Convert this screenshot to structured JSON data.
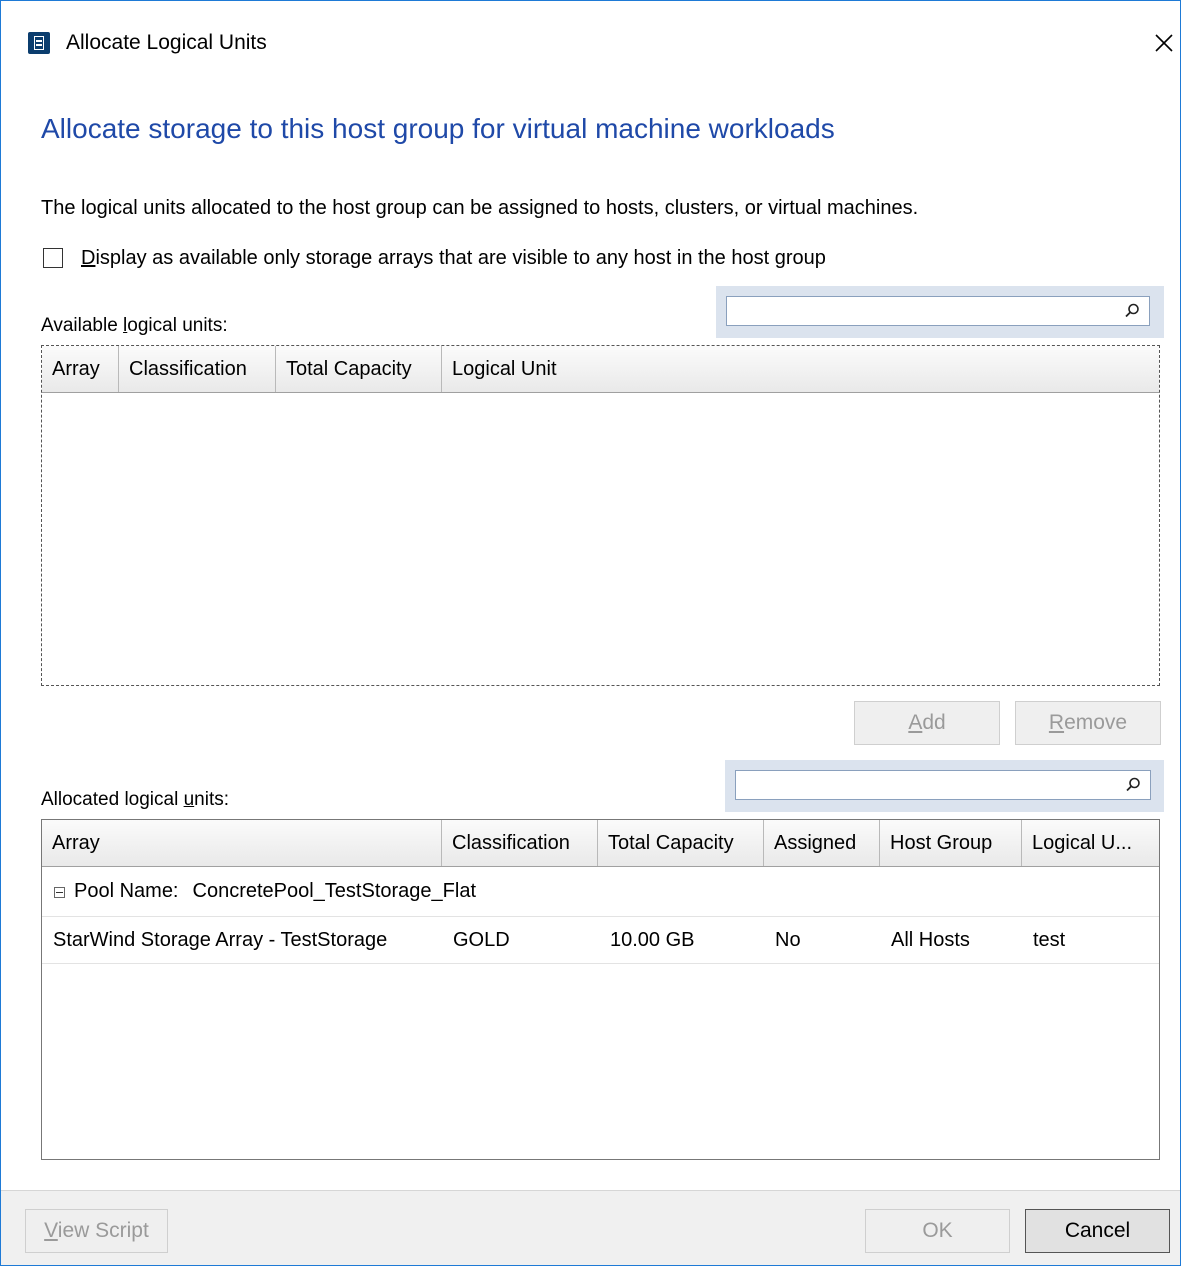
{
  "window": {
    "title": "Allocate Logical Units",
    "icon": "app-icon",
    "close_icon": "close-icon"
  },
  "heading": "Allocate storage to this host group for virtual machine workloads",
  "description": "The logical units allocated to the host group can be assigned to hosts, clusters, or virtual machines.",
  "filter_checkbox": {
    "label_mnemonic": "D",
    "label_rest": "isplay as available only storage arrays that are visible to any host in the host group",
    "checked": false
  },
  "available": {
    "label_prefix": "Available ",
    "label_mnemonic": "l",
    "label_suffix": "ogical units:",
    "search": {
      "value": "",
      "placeholder": "",
      "icon": "search-icon"
    },
    "columns": [
      "Array",
      "Classification",
      "Total Capacity",
      "Logical Unit"
    ],
    "rows": []
  },
  "buttons": {
    "add_mnemonic": "A",
    "add_rest": "dd",
    "remove_mnemonic": "R",
    "remove_rest": "emove"
  },
  "allocated": {
    "label_prefix": "Allocated logical ",
    "label_mnemonic": "u",
    "label_suffix": "nits:",
    "search": {
      "value": "",
      "placeholder": "",
      "icon": "search-icon"
    },
    "columns": [
      "Array",
      "Classification",
      "Total Capacity",
      "Assigned",
      "Host Group",
      "Logical U..."
    ],
    "group": {
      "key": "Pool Name:",
      "value": "ConcretePool_TestStorage_Flat",
      "expanded": true
    },
    "rows": [
      {
        "array": "StarWind Storage Array - TestStorage",
        "classification": "GOLD",
        "total_capacity": "10.00 GB",
        "assigned": "No",
        "host_group": "All Hosts",
        "logical_unit": "test"
      }
    ]
  },
  "footer": {
    "view_script_mnemonic": "V",
    "view_script_rest": "iew Script",
    "ok": "OK",
    "cancel": "Cancel"
  },
  "colors": {
    "heading": "#1f49a8",
    "window_border": "#1e7ad6",
    "footer_bg": "#f0f0f0"
  }
}
